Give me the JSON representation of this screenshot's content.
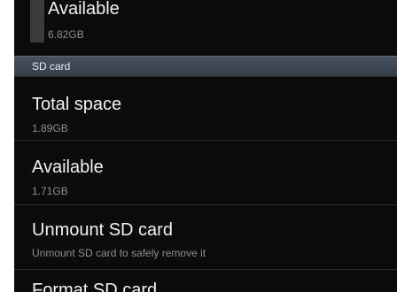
{
  "internal": {
    "available_label": "Available",
    "available_value": "6.82GB"
  },
  "sd_card": {
    "section_label": "SD card",
    "total_space_label": "Total space",
    "total_space_value": "1.89GB",
    "available_label": "Available",
    "available_value": "1.71GB",
    "unmount_label": "Unmount SD card",
    "unmount_desc": "Unmount SD card to safely remove it",
    "format_label": "Format SD card"
  }
}
